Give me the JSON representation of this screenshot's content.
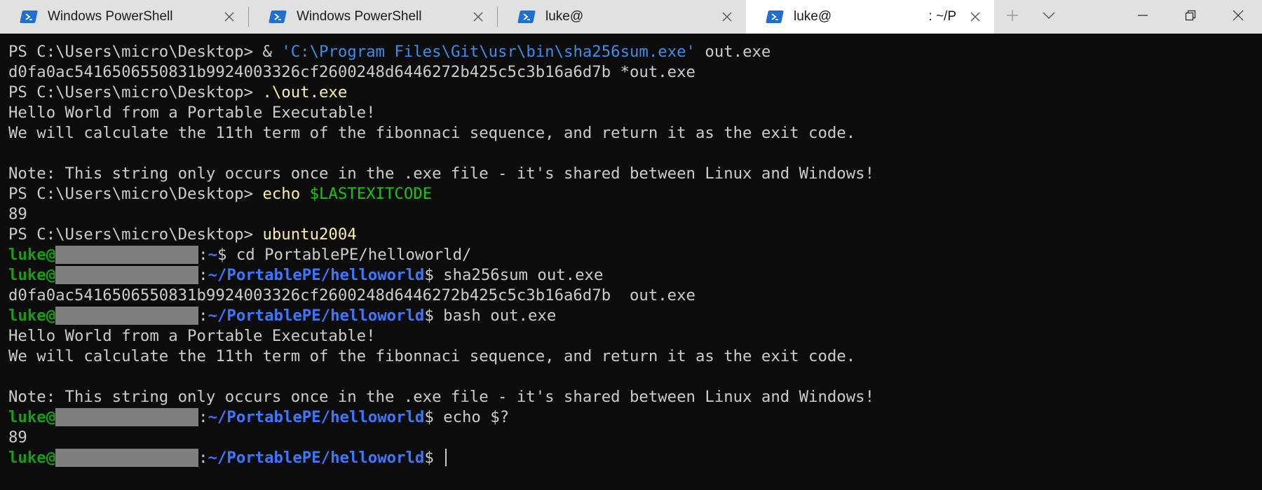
{
  "tabs": [
    {
      "title": "Windows PowerShell",
      "title_right": "",
      "active": false
    },
    {
      "title": "Windows PowerShell",
      "title_right": "",
      "active": false
    },
    {
      "title": "luke@",
      "title_right": "",
      "active": false
    },
    {
      "title": "luke@",
      "title_right": ": ~/P",
      "active": true
    }
  ],
  "toolbar": {
    "new_tab_icon": "plus-icon",
    "dropdown_icon": "chevron-down-icon"
  },
  "window_controls": [
    "minimize-icon",
    "restore-icon",
    "close-icon"
  ],
  "colors": {
    "background": "#0c0c0c",
    "text": "#cccccc",
    "command": "#f9f1a5",
    "string": "#3b8eea",
    "variable": "#16c60c",
    "bash_user": "#13a10e",
    "bash_path": "#3b78ff",
    "tabbar": "#e1e1e1",
    "tab_icon": "#1f6fd0"
  },
  "terminal": {
    "lines": [
      {
        "segments": [
          {
            "text": "PS C:\\Users\\micro\\Desktop> ",
            "style": "default"
          },
          {
            "text": "& ",
            "style": "default"
          },
          {
            "text": "'C:\\Program Files\\Git\\usr\\bin\\sha256sum.exe'",
            "style": "blue"
          },
          {
            "text": " out.exe",
            "style": "default"
          }
        ]
      },
      {
        "segments": [
          {
            "text": "d0fa0ac5416506550831b9924003326cf2600248d6446272b425c5c3b16a6d7b *out.exe",
            "style": "default"
          }
        ]
      },
      {
        "segments": [
          {
            "text": "PS C:\\Users\\micro\\Desktop> ",
            "style": "default"
          },
          {
            "text": ".\\out.exe",
            "style": "yellow"
          }
        ]
      },
      {
        "segments": [
          {
            "text": "Hello World from a Portable Executable!",
            "style": "default"
          }
        ]
      },
      {
        "segments": [
          {
            "text": "We will calculate the 11th term of the fibonnaci sequence, and return it as the exit code.",
            "style": "default"
          }
        ]
      },
      {
        "segments": []
      },
      {
        "segments": [
          {
            "text": "Note: This string only occurs once in the .exe file - it's shared between Linux and Windows!",
            "style": "default"
          }
        ]
      },
      {
        "segments": [
          {
            "text": "PS C:\\Users\\micro\\Desktop> ",
            "style": "default"
          },
          {
            "text": "echo ",
            "style": "yellow"
          },
          {
            "text": "$LASTEXITCODE",
            "style": "green"
          }
        ]
      },
      {
        "segments": [
          {
            "text": "89",
            "style": "default"
          }
        ]
      },
      {
        "segments": [
          {
            "text": "PS C:\\Users\\micro\\Desktop> ",
            "style": "default"
          },
          {
            "text": "ubuntu2004",
            "style": "yellow"
          }
        ]
      },
      {
        "segments": [
          {
            "text": "luke@",
            "style": "lgreen"
          },
          {
            "text": "",
            "style": "redact"
          },
          {
            "text": ":",
            "style": "default"
          },
          {
            "text": "~",
            "style": "path"
          },
          {
            "text": "$ cd PortablePE/helloworld/",
            "style": "default"
          }
        ]
      },
      {
        "segments": [
          {
            "text": "luke@",
            "style": "lgreen"
          },
          {
            "text": "",
            "style": "redact"
          },
          {
            "text": ":",
            "style": "default"
          },
          {
            "text": "~/PortablePE/helloworld",
            "style": "path"
          },
          {
            "text": "$ sha256sum out.exe",
            "style": "default"
          }
        ]
      },
      {
        "segments": [
          {
            "text": "d0fa0ac5416506550831b9924003326cf2600248d6446272b425c5c3b16a6d7b  out.exe",
            "style": "default"
          }
        ]
      },
      {
        "segments": [
          {
            "text": "luke@",
            "style": "lgreen"
          },
          {
            "text": "",
            "style": "redact"
          },
          {
            "text": ":",
            "style": "default"
          },
          {
            "text": "~/PortablePE/helloworld",
            "style": "path"
          },
          {
            "text": "$ bash out.exe",
            "style": "default"
          }
        ]
      },
      {
        "segments": [
          {
            "text": "Hello World from a Portable Executable!",
            "style": "default"
          }
        ]
      },
      {
        "segments": [
          {
            "text": "We will calculate the 11th term of the fibonnaci sequence, and return it as the exit code.",
            "style": "default"
          }
        ]
      },
      {
        "segments": []
      },
      {
        "segments": [
          {
            "text": "Note: This string only occurs once in the .exe file - it's shared between Linux and Windows!",
            "style": "default"
          }
        ]
      },
      {
        "segments": [
          {
            "text": "luke@",
            "style": "lgreen"
          },
          {
            "text": "",
            "style": "redact"
          },
          {
            "text": ":",
            "style": "default"
          },
          {
            "text": "~/PortablePE/helloworld",
            "style": "path"
          },
          {
            "text": "$ echo $?",
            "style": "default"
          }
        ]
      },
      {
        "segments": [
          {
            "text": "89",
            "style": "default"
          }
        ]
      },
      {
        "segments": [
          {
            "text": "luke@",
            "style": "lgreen"
          },
          {
            "text": "",
            "style": "redact"
          },
          {
            "text": ":",
            "style": "default"
          },
          {
            "text": "~/PortablePE/helloworld",
            "style": "path"
          },
          {
            "text": "$ ",
            "style": "default"
          },
          {
            "text": "",
            "style": "cursor"
          }
        ]
      }
    ]
  }
}
